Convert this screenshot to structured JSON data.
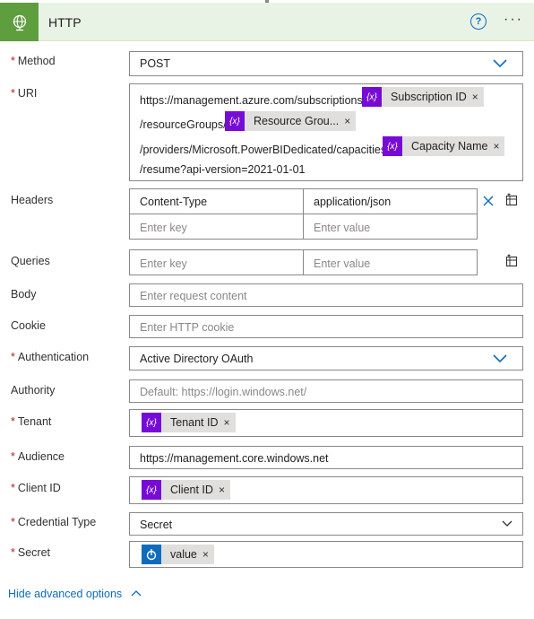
{
  "header": {
    "title": "HTTP",
    "help": "?",
    "more": "···"
  },
  "method": {
    "label": "Method",
    "value": "POST"
  },
  "uri": {
    "label": "URI",
    "line1": "https://management.azure.com/subscriptions/",
    "token1": "Subscription ID",
    "line2": "/resourceGroups/",
    "token2": "Resource Grou...",
    "line3": "/providers/Microsoft.PowerBIDedicated/capacities/",
    "token3": "Capacity Name",
    "line4": "/resume?api-version=2021-01-01"
  },
  "headers": {
    "label": "Headers",
    "key1": "Content-Type",
    "value1": "application/json",
    "key_placeholder": "Enter key",
    "value_placeholder": "Enter value"
  },
  "queries": {
    "label": "Queries",
    "key_placeholder": "Enter key",
    "value_placeholder": "Enter value"
  },
  "body": {
    "label": "Body",
    "placeholder": "Enter request content"
  },
  "cookie": {
    "label": "Cookie",
    "placeholder": "Enter HTTP cookie"
  },
  "authentication": {
    "label": "Authentication",
    "value": "Active Directory OAuth"
  },
  "authority": {
    "label": "Authority",
    "placeholder": "Default: https://login.windows.net/"
  },
  "tenant": {
    "label": "Tenant",
    "token": "Tenant ID"
  },
  "audience": {
    "label": "Audience",
    "value": "https://management.core.windows.net"
  },
  "client_id": {
    "label": "Client ID",
    "token": "Client ID"
  },
  "credential_type": {
    "label": "Credential Type",
    "value": "Secret"
  },
  "secret": {
    "label": "Secret",
    "token": "value"
  },
  "advanced": {
    "label": "Hide advanced options"
  },
  "token_icon_text": "{x}",
  "close_glyph": "×",
  "required_mark": "*",
  "colors": {
    "accent": "#0f6cbd",
    "header_bg": "#e9f3e5",
    "header_icon_bg": "#5e9e3f",
    "token_icon": "#770bd6",
    "required": "#a4262c"
  }
}
